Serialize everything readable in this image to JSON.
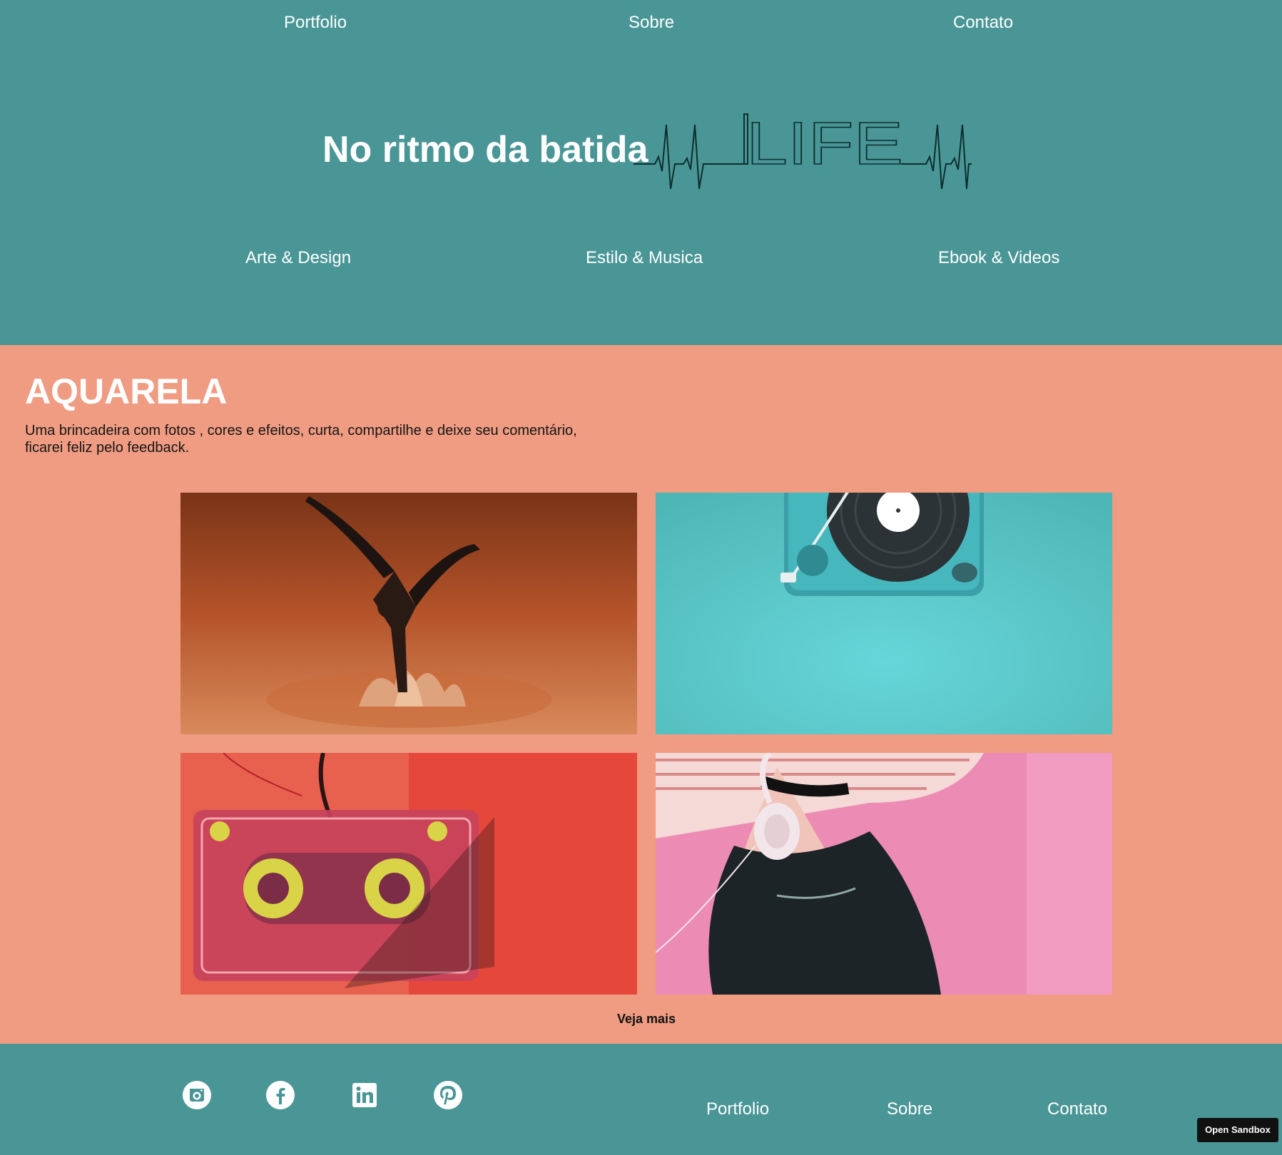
{
  "top_nav": [
    "Portfolio",
    "Sobre",
    "Contato"
  ],
  "hero": {
    "title": "No ritmo da batida",
    "logo_text": "LIFE"
  },
  "categories": [
    "Arte & Design",
    "Estilo & Musica",
    "Ebook & Videos"
  ],
  "section": {
    "title": "AQUARELA",
    "description": "Uma brincadeira com fotos , cores e efeitos, curta, compartilhe e deixe seu comentário, ficarei feliz pelo feedback.",
    "more_label": "Veja mais",
    "images": [
      "dancer-splash-photo",
      "turntable-photo",
      "cassette-tape-photo",
      "girl-headphones-photo"
    ]
  },
  "footer": {
    "social": [
      "instagram-icon",
      "facebook-icon",
      "linkedin-icon",
      "pinterest-icon"
    ],
    "nav": [
      "Portfolio",
      "Sobre",
      "Contato"
    ]
  },
  "sandbox_label": "Open Sandbox",
  "colors": {
    "teal": "#4a9696",
    "salmon": "#ef9c82",
    "white": "#ffffff"
  }
}
